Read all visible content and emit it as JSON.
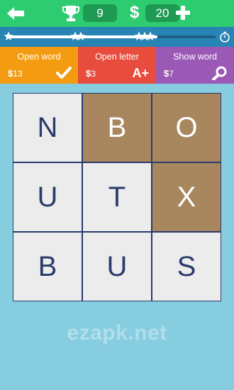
{
  "header": {
    "back_icon": "left-arrow-icon",
    "trophy_icon": "trophy-icon",
    "score": "9",
    "currency_symbol": "$",
    "coins": "20",
    "add_icon": "plus-icon"
  },
  "progress": {
    "fill_fraction": 0.72,
    "star_count": 3,
    "timer_icon": "stopwatch-icon"
  },
  "hints": {
    "open_word": {
      "label": "Open word",
      "currency": "$",
      "cost": "13",
      "icon": "check-icon"
    },
    "open_letter": {
      "label": "Open letter",
      "currency": "$",
      "cost": "3",
      "icon_text": "A+"
    },
    "show_word": {
      "label": "Show word",
      "currency": "$",
      "cost": "7",
      "icon": "magnifier-icon"
    }
  },
  "board": {
    "cells": [
      {
        "letter": "N",
        "state": "light"
      },
      {
        "letter": "B",
        "state": "dark"
      },
      {
        "letter": "O",
        "state": "dark"
      },
      {
        "letter": "U",
        "state": "light"
      },
      {
        "letter": "T",
        "state": "light"
      },
      {
        "letter": "X",
        "state": "dark"
      },
      {
        "letter": "B",
        "state": "light"
      },
      {
        "letter": "U",
        "state": "light"
      },
      {
        "letter": "S",
        "state": "light"
      }
    ]
  },
  "watermark": "ezapk.net",
  "colors": {
    "top_bar": "#2ecc71",
    "progress_bar": "#2784b4",
    "open_word": "#f39c12",
    "open_letter": "#e74c3c",
    "show_word": "#9b59b6",
    "cell_light": "#ececec",
    "cell_dark": "#a8875f",
    "background": "#87cde0"
  }
}
